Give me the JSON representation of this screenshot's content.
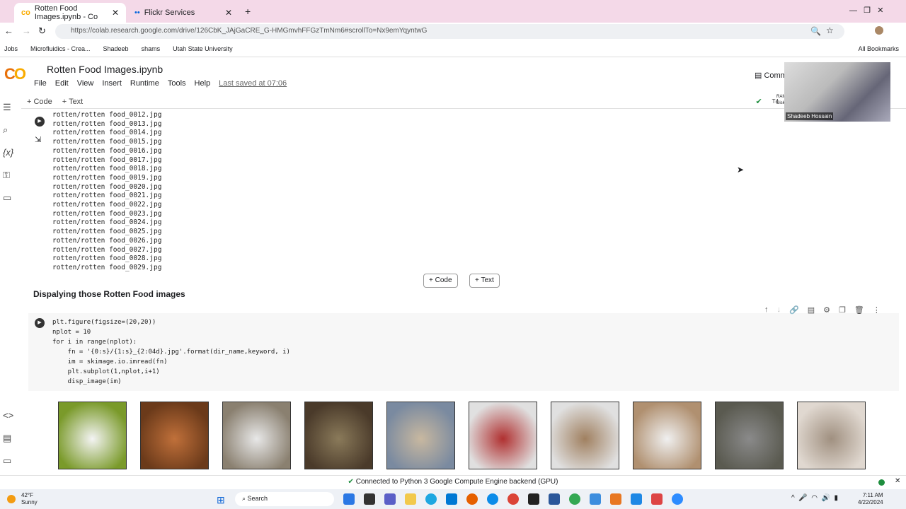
{
  "browser": {
    "tabs": [
      {
        "label": "Rotten Food Images.ipynb - Co"
      },
      {
        "label": "Flickr Services"
      }
    ],
    "url": "https://colab.research.google.com/drive/126CbK_JAjGaCRE_G-HMGmvhFFGzTmNm6#scrollTo=Nx9emYqyntwG",
    "bookmarks": [
      "Jobs",
      "Microfluidics - Crea...",
      "Shadeeb",
      "shams",
      "Utah State University"
    ],
    "all_bookmarks": "All Bookmarks"
  },
  "colab": {
    "logo": "CO",
    "title": "Rotten Food Images.ipynb",
    "menu": [
      "File",
      "Edit",
      "View",
      "Insert",
      "Runtime",
      "Tools",
      "Help"
    ],
    "last_saved": "Last saved at 07:06",
    "comment": "Comm",
    "add_code": "+ Code",
    "add_text": "+ Text",
    "runtime": "T4",
    "ram": "RAM",
    "disk": "Disk"
  },
  "output_lines": [
    "rotten/rotten food_0012.jpg",
    "rotten/rotten food_0013.jpg",
    "rotten/rotten food_0014.jpg",
    "rotten/rotten food_0015.jpg",
    "rotten/rotten food_0016.jpg",
    "rotten/rotten food_0017.jpg",
    "rotten/rotten food_0018.jpg",
    "rotten/rotten food_0019.jpg",
    "rotten/rotten food_0020.jpg",
    "rotten/rotten food_0021.jpg",
    "rotten/rotten food_0022.jpg",
    "rotten/rotten food_0023.jpg",
    "rotten/rotten food_0024.jpg",
    "rotten/rotten food_0025.jpg",
    "rotten/rotten food_0026.jpg",
    "rotten/rotten food_0027.jpg",
    "rotten/rotten food_0028.jpg",
    "rotten/rotten food_0029.jpg"
  ],
  "insert": {
    "code": "Code",
    "text": "Text"
  },
  "heading": "Dispalying those Rotten Food images",
  "code_lines": [
    "plt.figure(figsize=(20,20))",
    "nplot = 10",
    "for i in range(nplot):",
    "    fn = '{0:s}/{1:s}_{2:04d}.jpg'.format(dir_name,keyword, i)",
    "    im = skimage.io.imread(fn)",
    "    plt.subplot(1,nplot,i+1)",
    "    disp_image(im)"
  ],
  "thumb_colors": [
    [
      "#f4f4f4",
      "#7a9a2a"
    ],
    [
      "#c0703a",
      "#6b3a1a"
    ],
    [
      "#e8e8e8",
      "#8a8070"
    ],
    [
      "#8a7a5a",
      "#4a3a2a"
    ],
    [
      "#c8b8a0",
      "#7a8aa0"
    ],
    [
      "#b03030",
      "#e0e0e0"
    ],
    [
      "#a08060",
      "#e0e0e0"
    ],
    [
      "#f0f0f0",
      "#b09070"
    ],
    [
      "#8a8a8a",
      "#5a5a50"
    ],
    [
      "#a09080",
      "#e0d8d0"
    ]
  ],
  "status": "Connected to Python 3 Google Compute Engine backend (GPU)",
  "video": {
    "name": "Shadeeb Hossain"
  },
  "taskbar": {
    "weather_temp": "42°F",
    "weather_desc": "Sunny",
    "search": "Search",
    "time": "7:11 AM",
    "date": "4/22/2024"
  }
}
